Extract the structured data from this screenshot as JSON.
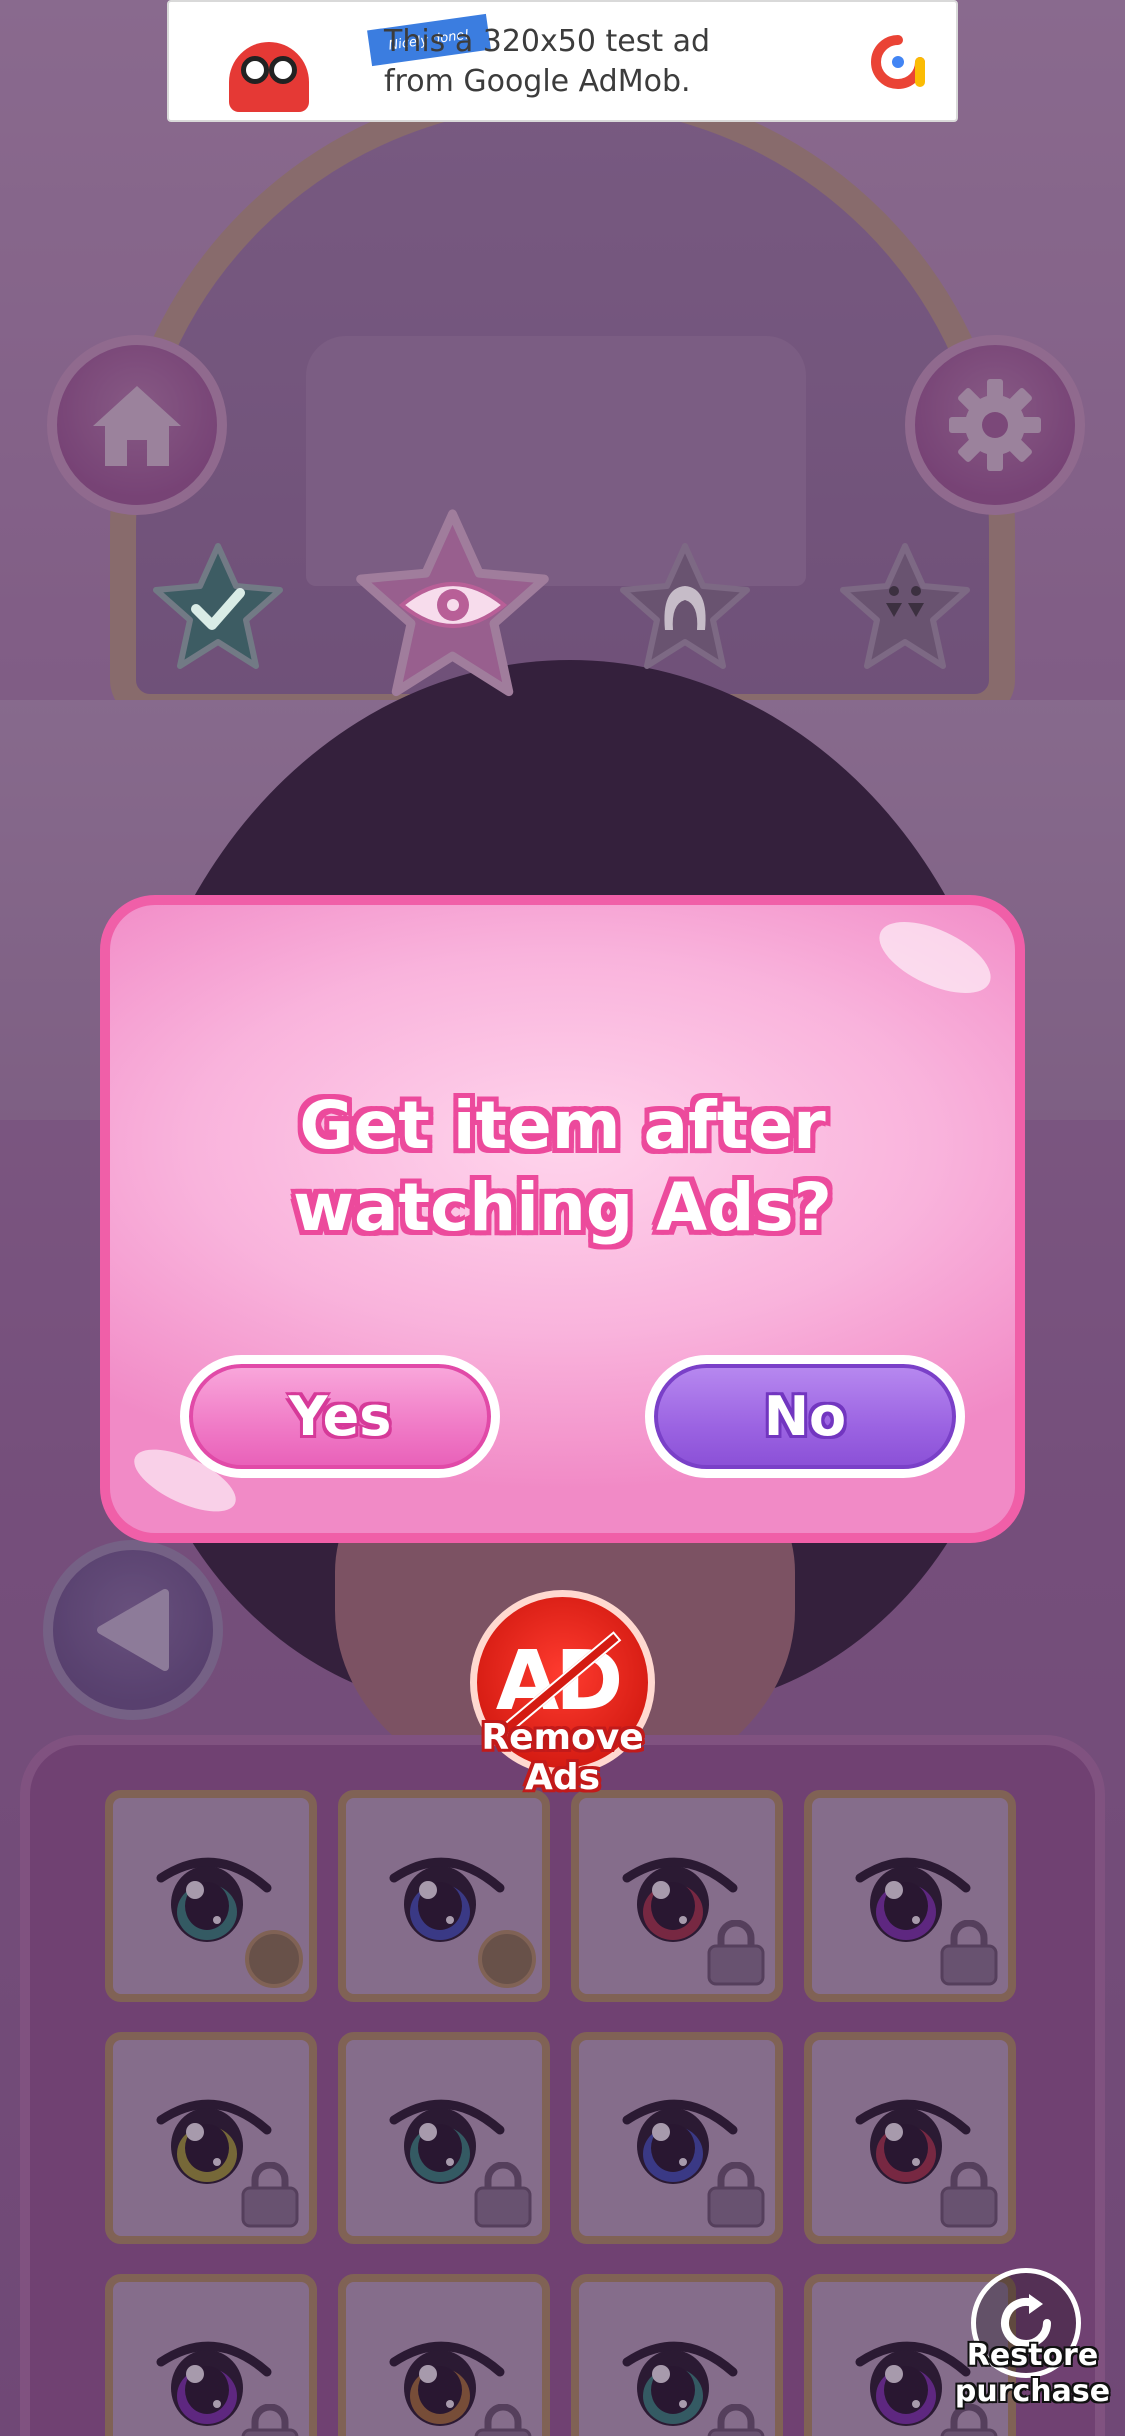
{
  "ad_banner": {
    "text": "This a 320x50 test ad from Google AdMob.",
    "flag_text": "Nicely done!"
  },
  "tabs": [
    {
      "name": "done",
      "icon": "checkmark-icon",
      "color": "#3f8f7a"
    },
    {
      "name": "eyes",
      "icon": "eye-icon",
      "color": "#e394c8",
      "selected": true
    },
    {
      "name": "hair",
      "icon": "hair-icon",
      "color": "#8f7f93"
    },
    {
      "name": "accessories",
      "icon": "earrings-icon",
      "color": "#8f7f93"
    }
  ],
  "dialog": {
    "message": "Get item after watching Ads?",
    "yes_label": "Yes",
    "no_label": "No"
  },
  "remove_ads": {
    "badge_text": "AD",
    "label": "Remove Ads"
  },
  "restore": {
    "label": "Restore purchase"
  },
  "items": [
    {
      "iris": "#2f8a7a",
      "status": "ad"
    },
    {
      "iris": "#3a4fb8",
      "status": "ad"
    },
    {
      "iris": "#a8303f",
      "status": "locked"
    },
    {
      "iris": "#7a2fb0",
      "status": "locked"
    },
    {
      "iris": "#a6a42c",
      "status": "locked"
    },
    {
      "iris": "#2f8a7a",
      "status": "locked"
    },
    {
      "iris": "#3a4fb8",
      "status": "locked"
    },
    {
      "iris": "#a8303f",
      "status": "locked"
    },
    {
      "iris": "#7a2fb0",
      "status": "locked"
    },
    {
      "iris": "#a8742c",
      "status": "locked"
    },
    {
      "iris": "#2f8a7a",
      "status": "locked"
    },
    {
      "iris": "#7a2fb0",
      "status": "locked"
    }
  ],
  "colors": {
    "dialog_border": "#f05fa8",
    "yes_button": "#f07ac6",
    "no_button": "#9b63e2",
    "remove_ads_red": "#d41b12"
  }
}
